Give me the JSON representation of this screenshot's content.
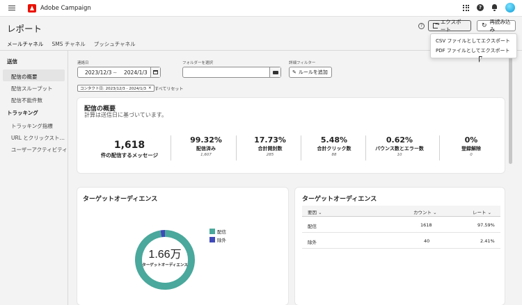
{
  "app": {
    "name": "Adobe Campaign"
  },
  "header": {
    "title": "レポート",
    "export_label": "エクスポート",
    "reload_label": "再読み込み"
  },
  "export_menu": [
    "CSV ファイルとしてエクスポート",
    "PDF ファイルとしてエクスポート"
  ],
  "tabs": [
    "メールチャネル",
    "SMS チャネル",
    "プッシュチャネル"
  ],
  "sidebar": {
    "groups": [
      {
        "label": "送信",
        "items": [
          "配信の概要",
          "配信スループット",
          "配信不能件数"
        ]
      },
      {
        "label": "トラッキング",
        "items": [
          "トラッキング指標",
          "URL とクリックスト…",
          "ユーザーアクティビティ"
        ]
      }
    ]
  },
  "filters": {
    "date_label": "連絡日",
    "date_from": "2023/12/3",
    "date_sep": "~",
    "date_to": "2024/1/3",
    "folder_label": "フォルダーを選択",
    "folder_value": "",
    "advanced_label": "詳細フィルター",
    "add_rule_label": "ルールを追加",
    "chip_text": "コンタクト日: 2023/12/3 - 2024/1/3",
    "reset_label": "すべてリセット"
  },
  "summary": {
    "title": "配信の概要",
    "subtitle": "計算は送信日に基づいています。",
    "main": {
      "value": "1,618",
      "label": "件の配信するメッセージ"
    },
    "kpis": [
      {
        "value": "99.32%",
        "label": "配信済み",
        "count": "1,607"
      },
      {
        "value": "17.73%",
        "label": "合計開封数",
        "count": "285"
      },
      {
        "value": "5.48%",
        "label": "合計クリック数",
        "count": "88"
      },
      {
        "value": "0.62%",
        "label": "バウンス数とエラー数",
        "count": "10"
      },
      {
        "value": "0%",
        "label": "登録解除",
        "count": "0"
      }
    ]
  },
  "audience_chart": {
    "title": "ターゲットオーディエンス",
    "center_value": "1.66万",
    "center_label": "ターゲットオーディエンス",
    "legend": [
      {
        "label": "配信",
        "color": "#4aa89c"
      },
      {
        "label": "除外",
        "color": "#3f4ab8"
      }
    ]
  },
  "audience_table": {
    "title": "ターゲットオーディエンス",
    "headers": [
      "要因",
      "カウント",
      "レート"
    ],
    "rows": [
      {
        "reason": "配信",
        "count": "1618",
        "rate": "97.59%"
      },
      {
        "reason": "除外",
        "count": "40",
        "rate": "2.41%"
      }
    ]
  },
  "chart_data": {
    "type": "pie",
    "categories": [
      "配信",
      "除外"
    ],
    "values": [
      1618,
      40
    ],
    "title": "ターゲットオーディエンス"
  }
}
